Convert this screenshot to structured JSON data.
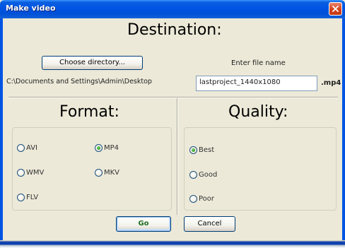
{
  "window": {
    "title": "Make video"
  },
  "destination": {
    "heading": "Destination:",
    "choose_directory_label": "Choose directory...",
    "enter_file_name_label": "Enter file name",
    "directory_path": "C:\\Documents and Settings\\Admin\\Desktop",
    "file_name_value": "lastproject_1440x1080",
    "extension": ".mp4"
  },
  "format": {
    "heading": "Format:",
    "options": [
      {
        "label": "AVI",
        "checked": false
      },
      {
        "label": "MP4",
        "checked": true
      },
      {
        "label": "WMV",
        "checked": false
      },
      {
        "label": "MKV",
        "checked": false
      },
      {
        "label": "FLV",
        "checked": false
      }
    ]
  },
  "quality": {
    "heading": "Quality:",
    "options": [
      {
        "label": "Best",
        "checked": true
      },
      {
        "label": "Good",
        "checked": false
      },
      {
        "label": "Poor",
        "checked": false
      }
    ]
  },
  "actions": {
    "go_label": "Go",
    "cancel_label": "Cancel"
  },
  "colors": {
    "titlebar": "#0054e3",
    "window_bg": "#ece9d8",
    "close_button": "#d6401b",
    "radio_check": "#2f9b2a",
    "go_text": "#1e6d1e"
  },
  "icons": {
    "close": "close-icon"
  }
}
